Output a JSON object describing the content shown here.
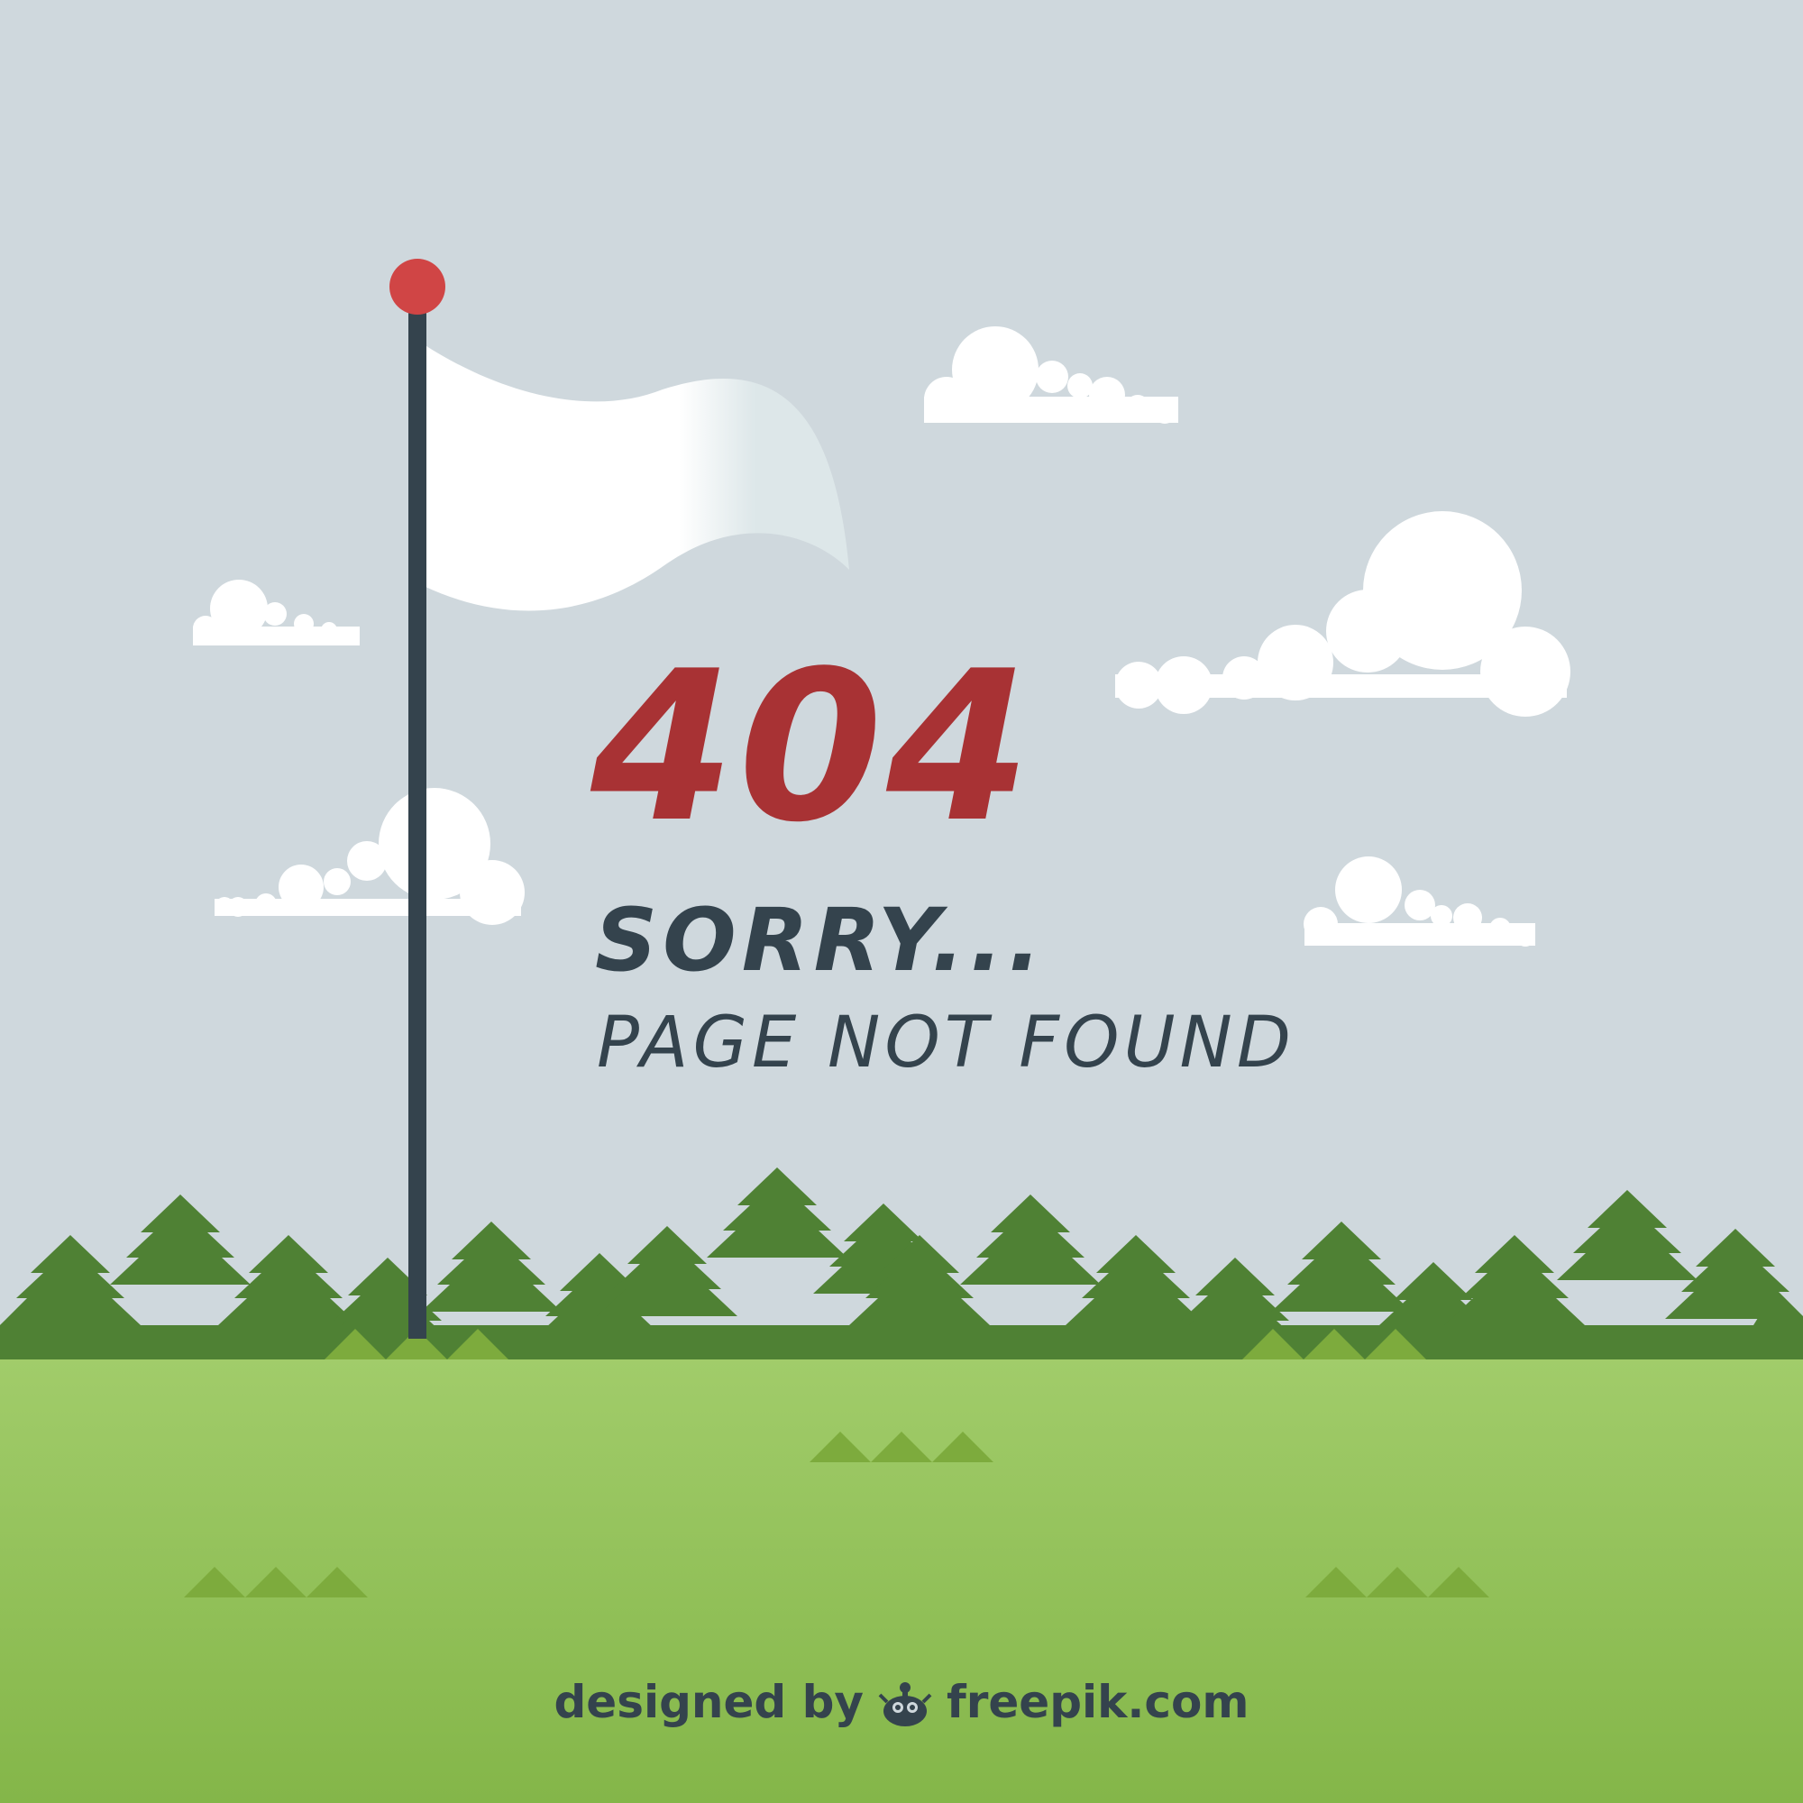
{
  "message": {
    "code": "404",
    "title": "SORRY...",
    "subtitle": "PAGE NOT FOUND"
  },
  "credit": {
    "prefix": "designed by",
    "brand": "freepik.com",
    "icon": "freepik-logo-icon"
  },
  "colors": {
    "sky": "#cfd8dd",
    "cloud": "#ffffff",
    "flag": "#ffffff",
    "flag_shade": "#dde7e9",
    "pole": "#34434d",
    "pole_ball": "#d04545",
    "code": "#a83234",
    "text": "#34434d",
    "trees": "#4f8134",
    "grass_top": "#a1cc6a",
    "grass_bottom": "#84b649",
    "tufts": "#7dab3d"
  }
}
